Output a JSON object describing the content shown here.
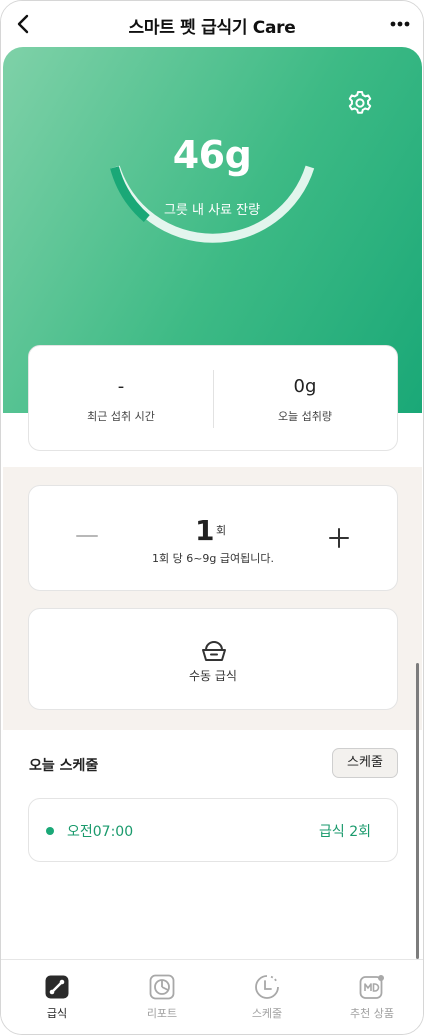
{
  "header": {
    "title": "스마트 펫 급식기 Care",
    "back_icon": "chevron-left-icon",
    "more_icon": "more-horizontal-icon"
  },
  "hero": {
    "amount": "46g",
    "amount_label": "그릇 내 사료 잔량",
    "settings_icon": "gear-icon",
    "bowl_fill_fraction": 0.23,
    "accent_color": "#1aa877"
  },
  "stats": {
    "last_intake_value": "-",
    "last_intake_label": "최근 섭취 시간",
    "today_intake_value": "0g",
    "today_intake_label": "오늘 섭취량"
  },
  "feeding": {
    "count": "1",
    "count_unit": "회",
    "description": "1회 당 6~9g 급여됩니다.",
    "minus_icon": "minus-icon",
    "plus_icon": "plus-icon"
  },
  "manual_feed": {
    "label": "수동 급식",
    "icon": "food-bowl-icon"
  },
  "schedule": {
    "title": "오늘 스케줄",
    "button_label": "스케줄",
    "items": [
      {
        "time": "오전07:00",
        "feed": "급식 2회"
      }
    ]
  },
  "bottom_nav": {
    "items": [
      {
        "label": "급식",
        "icon": "feeding-icon",
        "active": true
      },
      {
        "label": "리포트",
        "icon": "report-chart-icon",
        "active": false
      },
      {
        "label": "스케줄",
        "icon": "schedule-clock-icon",
        "active": false
      },
      {
        "label": "추천 상품",
        "icon": "md-recommend-icon",
        "active": false
      }
    ]
  }
}
